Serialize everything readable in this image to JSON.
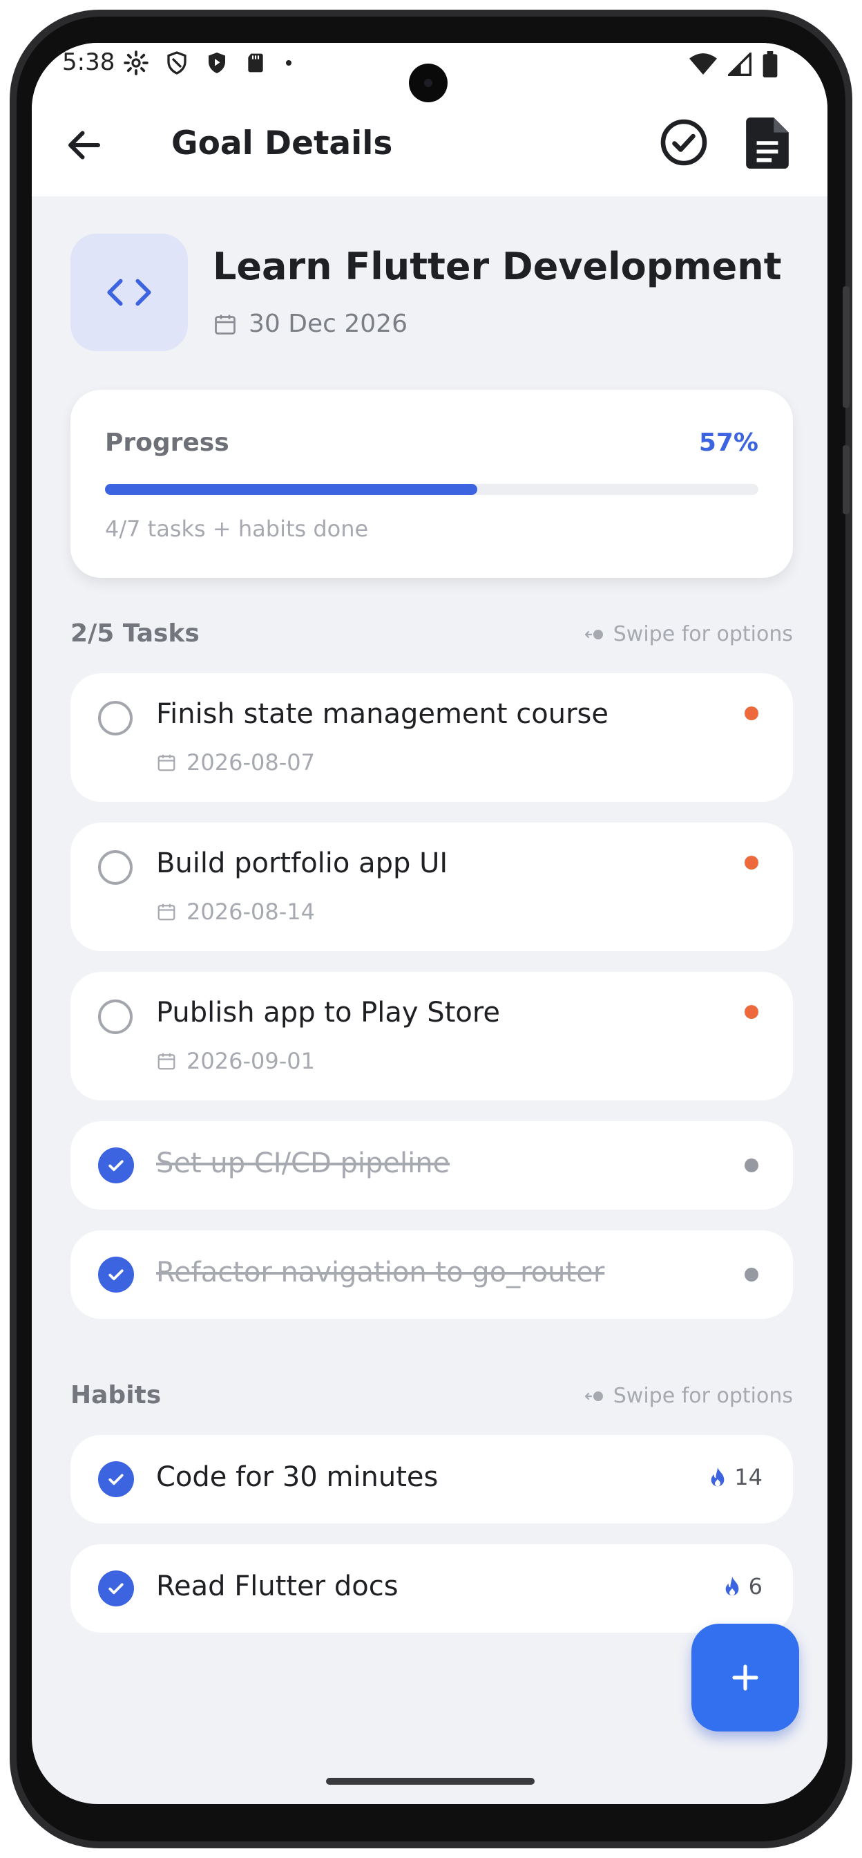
{
  "status_bar": {
    "time": "5:38"
  },
  "header": {
    "title": "Goal Details"
  },
  "goal": {
    "title": "Learn Flutter Development",
    "date": "30 Dec 2026",
    "icon": "code-icon"
  },
  "progress": {
    "label": "Progress",
    "percent_text": "57%",
    "fraction": 0.57,
    "summary": "4/7 tasks + habits done"
  },
  "tasks_section": {
    "heading": "2/5 Tasks",
    "swipe_hint": "Swipe for options",
    "items": [
      {
        "title": "Finish state management course",
        "date": "2026-08-07",
        "done": false,
        "priority_color": "#ee6a3c"
      },
      {
        "title": "Build portfolio app UI",
        "date": "2026-08-14",
        "done": false,
        "priority_color": "#ee6a3c"
      },
      {
        "title": "Publish app to Play Store",
        "date": "2026-09-01",
        "done": false,
        "priority_color": "#ee6a3c"
      },
      {
        "title": "Set up CI/CD pipeline",
        "done": true,
        "priority_color": "#9698a2"
      },
      {
        "title": "Refactor navigation to go_router",
        "done": true,
        "priority_color": "#9698a2"
      }
    ]
  },
  "habits_section": {
    "heading": "Habits",
    "swipe_hint": "Swipe for options",
    "items": [
      {
        "title": "Code for 30 minutes",
        "streak": "14",
        "done": true
      },
      {
        "title": "Read Flutter docs",
        "streak": "6",
        "done": true
      }
    ]
  },
  "colors": {
    "accent": "#3d64e0",
    "fab": "#3370ef",
    "priority_high": "#ee6a3c",
    "priority_done": "#9698a2"
  }
}
